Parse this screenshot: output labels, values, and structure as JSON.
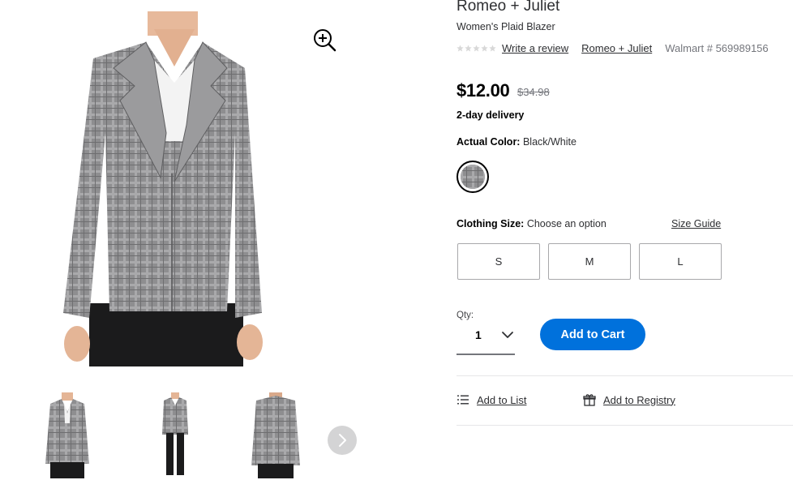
{
  "product": {
    "brand": "Romeo + Juliet",
    "name": "Women's Plaid Blazer",
    "rating_stars": 5,
    "write_review": "Write a review",
    "brand_link": "Romeo + Juliet",
    "sku": "Walmart # 569989156"
  },
  "pricing": {
    "price": "$12.00",
    "was_price": "$34.98",
    "delivery": "2-day delivery"
  },
  "color": {
    "label": "Actual Color:",
    "value": "Black/White"
  },
  "size": {
    "label": "Clothing Size:",
    "value": "Choose an option",
    "guide_link": "Size Guide",
    "options": [
      "S",
      "M",
      "L"
    ]
  },
  "quantity": {
    "label": "Qty:",
    "value": "1"
  },
  "cart": {
    "add_label": "Add to Cart"
  },
  "actions": {
    "list": "Add to List",
    "registry": "Add to Registry"
  },
  "icons": {
    "zoom": "zoom-in-icon",
    "next": "chevron-right-icon",
    "qty": "chevron-down-icon",
    "list": "list-icon",
    "registry": "gift-icon"
  },
  "colors": {
    "primary_blue": "#0071dc",
    "text": "#2e2f32",
    "muted": "#74767c"
  }
}
